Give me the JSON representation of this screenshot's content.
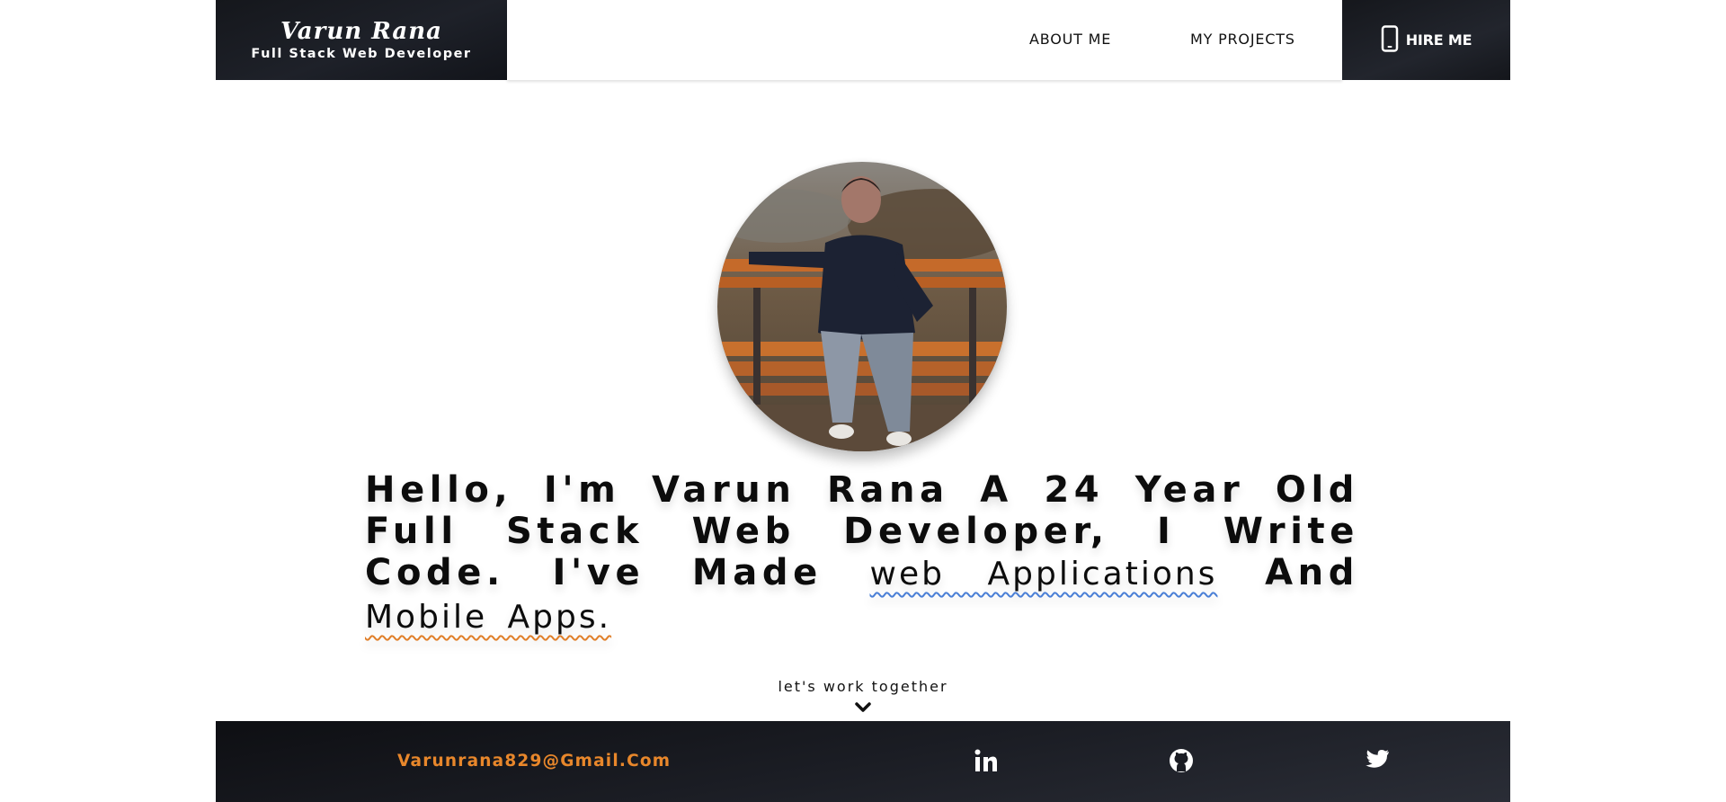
{
  "brand": {
    "name": "Varun Rana",
    "role": "Full Stack Web Developer"
  },
  "nav": {
    "about": "ABOUT ME",
    "projects": "MY PROJECTS"
  },
  "hire": {
    "label": "HIRE ME",
    "icon": "phone-icon"
  },
  "hero": {
    "avatar_alt": "profile photo",
    "intro_text": "Hello, I'm Varun Rana A 24 Year Old Full Stack Web Developer, I Write Code. I've Made",
    "highlight_1": "web Applications",
    "connector": "And",
    "highlight_2": "Mobile Apps.",
    "cta": "let's work together"
  },
  "footer": {
    "email": "Varunrana829@Gmail.Com",
    "social": [
      {
        "icon": "linkedin-icon"
      },
      {
        "icon": "github-icon"
      },
      {
        "icon": "twitter-icon"
      }
    ]
  },
  "colors": {
    "dark": "#1b1d24",
    "accent_orange": "#e8872b",
    "underline_blue": "#4a7fd6",
    "underline_orange": "#e07f2a"
  }
}
